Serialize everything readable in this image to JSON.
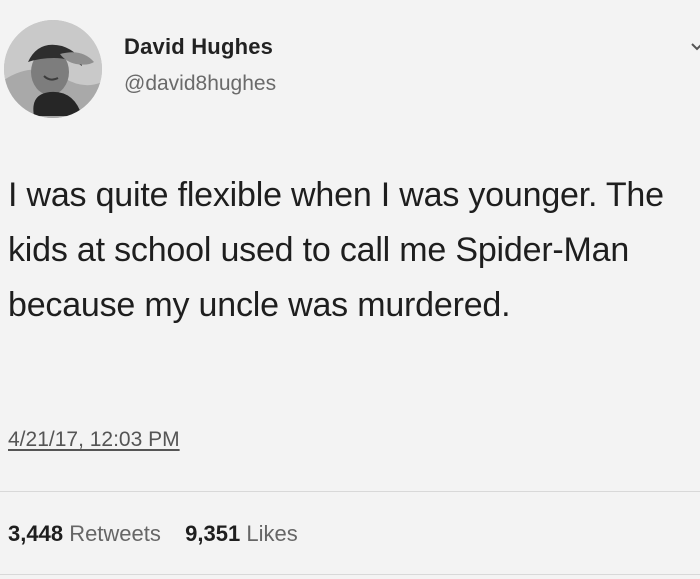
{
  "tweet": {
    "author": {
      "name": "David Hughes",
      "handle": "@david8hughes"
    },
    "text": "I was quite flexible when I was younger. The kids at school used to call me Spider-Man because my uncle was murdered.",
    "timestamp": "4/21/17, 12:03 PM",
    "stats": {
      "retweets_count": "3,448",
      "retweets_label": "Retweets",
      "likes_count": "9,351",
      "likes_label": "Likes"
    },
    "icons": {
      "menu": "chevron-down-icon"
    }
  }
}
